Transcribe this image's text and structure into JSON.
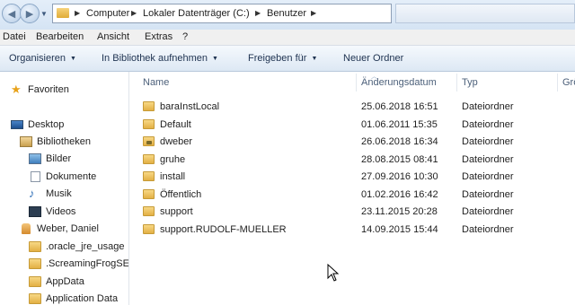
{
  "address": {
    "crumbs": [
      "Computer",
      "Lokaler Datenträger (C:)",
      "Benutzer"
    ],
    "folder_icon": "folder-icon"
  },
  "menu": [
    "Datei",
    "Bearbeiten",
    "Ansicht",
    "Extras",
    "?"
  ],
  "toolbar": {
    "organize": "Organisieren",
    "library": "In Bibliothek aufnehmen",
    "share": "Freigeben für",
    "new_folder": "Neuer Ordner"
  },
  "nav": [
    {
      "label": "Favoriten",
      "icon": "star-icon"
    },
    {
      "label": "Desktop",
      "icon": "desktop-icon"
    },
    {
      "label": "Bibliotheken",
      "icon": "libraries-icon"
    },
    {
      "label": "Bilder",
      "icon": "pictures-icon"
    },
    {
      "label": "Dokumente",
      "icon": "documents-icon"
    },
    {
      "label": "Musik",
      "icon": "music-icon"
    },
    {
      "label": "Videos",
      "icon": "videos-icon"
    },
    {
      "label": "Weber, Daniel",
      "icon": "user-folder-icon"
    },
    {
      "label": ".oracle_jre_usage",
      "icon": "folder-icon"
    },
    {
      "label": ".ScreamingFrogSE",
      "icon": "folder-icon"
    },
    {
      "label": "AppData",
      "icon": "folder-icon"
    },
    {
      "label": "Application Data",
      "icon": "folder-icon"
    }
  ],
  "columns": {
    "name": "Name",
    "date": "Änderungsdatum",
    "type": "Typ",
    "size": "Grö"
  },
  "files": [
    {
      "name": "baraInstLocal",
      "date": "25.06.2018 16:51",
      "type": "Dateiordner",
      "locked": false
    },
    {
      "name": "Default",
      "date": "01.06.2011 15:35",
      "type": "Dateiordner",
      "locked": false
    },
    {
      "name": "dweber",
      "date": "26.06.2018 16:34",
      "type": "Dateiordner",
      "locked": true
    },
    {
      "name": "gruhe",
      "date": "28.08.2015 08:41",
      "type": "Dateiordner",
      "locked": false
    },
    {
      "name": "install",
      "date": "27.09.2016 10:30",
      "type": "Dateiordner",
      "locked": false
    },
    {
      "name": "Öffentlich",
      "date": "01.02.2016 16:42",
      "type": "Dateiordner",
      "locked": false
    },
    {
      "name": "support",
      "date": "23.11.2015 20:28",
      "type": "Dateiordner",
      "locked": false
    },
    {
      "name": "support.RUDOLF-MUELLER",
      "date": "14.09.2015 15:44",
      "type": "Dateiordner",
      "locked": false
    }
  ]
}
